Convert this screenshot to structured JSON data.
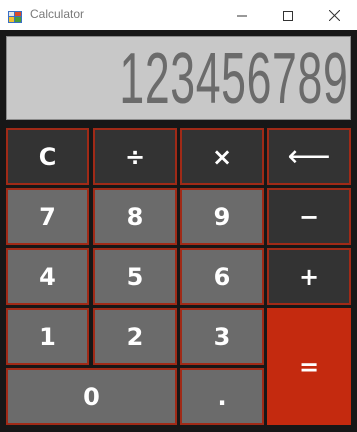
{
  "window": {
    "title": "Calculator",
    "controls": [
      "minimize",
      "maximize",
      "close"
    ]
  },
  "display": {
    "value": "123456789"
  },
  "buttons": {
    "clear": "C",
    "divide": "÷",
    "multiply": "×",
    "backspace": "⟵",
    "seven": "7",
    "eight": "8",
    "nine": "9",
    "minus": "−",
    "four": "4",
    "five": "5",
    "six": "6",
    "plus": "+",
    "one": "1",
    "two": "2",
    "three": "3",
    "equals": "=",
    "zero": "0",
    "decimal": "."
  },
  "colors": {
    "background": "#171717",
    "display_bg": "#c8c8c8",
    "display_text": "#6b6b6b",
    "operator_button": "#333333",
    "digit_button": "#6b6b6b",
    "equals_button": "#c42a0f",
    "button_border": "#a02a17"
  },
  "icons": {
    "app": "calculator-app-icon",
    "minimize": "minimize-icon",
    "maximize": "maximize-icon",
    "close": "close-icon"
  }
}
